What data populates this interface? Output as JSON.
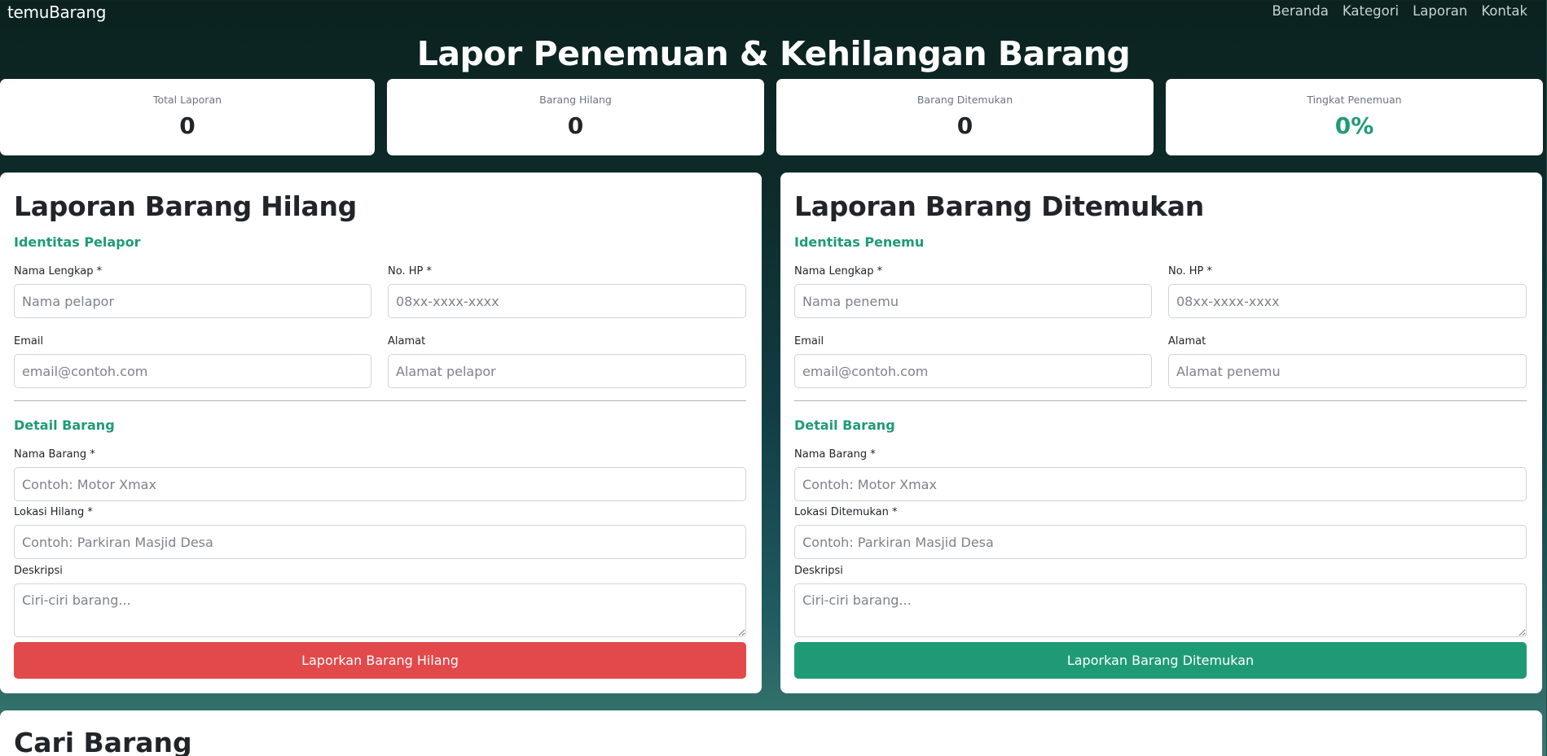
{
  "navbar": {
    "brand": "temuBarang",
    "links": [
      "Beranda",
      "Kategori",
      "Laporan",
      "Kontak"
    ]
  },
  "hero": {
    "title": "Lapor Penemuan & Kehilangan Barang"
  },
  "stats": [
    {
      "label": "Total Laporan",
      "value": "0"
    },
    {
      "label": "Barang Hilang",
      "value": "0"
    },
    {
      "label": "Barang Ditemukan",
      "value": "0"
    },
    {
      "label": "Tingkat Penemuan",
      "value": "0%"
    }
  ],
  "lost_form": {
    "title": "Laporan Barang Hilang",
    "section_identity": "Identitas Pelapor",
    "name_label": "Nama Lengkap *",
    "name_placeholder": "Nama pelapor",
    "phone_label": "No. HP *",
    "phone_placeholder": "08xx-xxxx-xxxx",
    "email_label": "Email",
    "email_placeholder": "email@contoh.com",
    "address_label": "Alamat",
    "address_placeholder": "Alamat pelapor",
    "section_detail": "Detail Barang",
    "item_label": "Nama Barang *",
    "item_placeholder": "Contoh: Motor Xmax",
    "location_label": "Lokasi Hilang *",
    "location_placeholder": "Contoh: Parkiran Masjid Desa",
    "desc_label": "Deskripsi",
    "desc_placeholder": "Ciri-ciri barang...",
    "submit_label": "Laporkan Barang Hilang",
    "submit_color": "#e2494b"
  },
  "found_form": {
    "title": "Laporan Barang Ditemukan",
    "section_identity": "Identitas Penemu",
    "name_label": "Nama Lengkap *",
    "name_placeholder": "Nama penemu",
    "phone_label": "No. HP *",
    "phone_placeholder": "08xx-xxxx-xxxx",
    "email_label": "Email",
    "email_placeholder": "email@contoh.com",
    "address_label": "Alamat",
    "address_placeholder": "Alamat penemu",
    "section_detail": "Detail Barang",
    "item_label": "Nama Barang *",
    "item_placeholder": "Contoh: Motor Xmax",
    "location_label": "Lokasi Ditemukan *",
    "location_placeholder": "Contoh: Parkiran Masjid Desa",
    "desc_label": "Deskripsi",
    "desc_placeholder": "Ciri-ciri barang...",
    "submit_label": "Laporkan Barang Ditemukan",
    "submit_color": "#1e9b76"
  },
  "search": {
    "title": "Cari Barang"
  },
  "colors": {
    "accent": "#1e9b76",
    "danger": "#e2494b",
    "background_top": "#0b221f",
    "background_bottom": "#3b7a72"
  }
}
